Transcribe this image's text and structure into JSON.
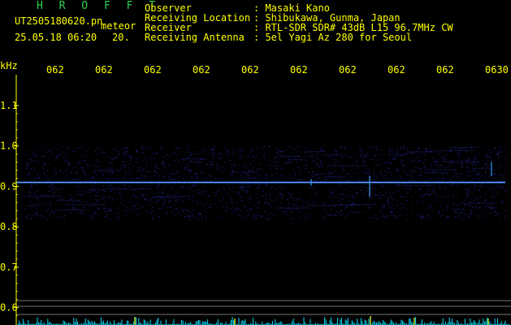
{
  "header": {
    "brand": "H R O F F T",
    "file_name": "UT2505180620.pn",
    "file_type": "meteor",
    "timestamp": "25.05.18 06:20",
    "number": "20."
  },
  "info": [
    {
      "key": "Observer",
      "value": ": Masaki Kano"
    },
    {
      "key": "Receiving Location",
      "value": ": Shibukawa, Gunma, Japan"
    },
    {
      "key": "Receiver",
      "value": ": RTL-SDR SDR# 43dB L15 96.7MHz CW"
    },
    {
      "key": "Receiving Antenna",
      "value": ": 5el Yagi Az 280 for Seoul"
    }
  ],
  "chart_data": {
    "type": "heatmap",
    "ylabel": "kHz",
    "y_ticks": [
      "1.1",
      "1.0",
      "0.9",
      "0.8",
      "0.7",
      "0.6"
    ],
    "x_ticks": [
      "062",
      "062",
      "062",
      "062",
      "062",
      "062",
      "062",
      "062",
      "062",
      "0630"
    ],
    "ylim": [
      0.6,
      1.1
    ],
    "carrier_khz": 0.91,
    "noise_band_khz": [
      0.82,
      1.0
    ],
    "colors": {
      "background": "#000000",
      "signal": "#3c6cff",
      "noise": "#2a2ab0",
      "spectrum": "#00e0ff",
      "axis_text": "#ffff00"
    }
  }
}
